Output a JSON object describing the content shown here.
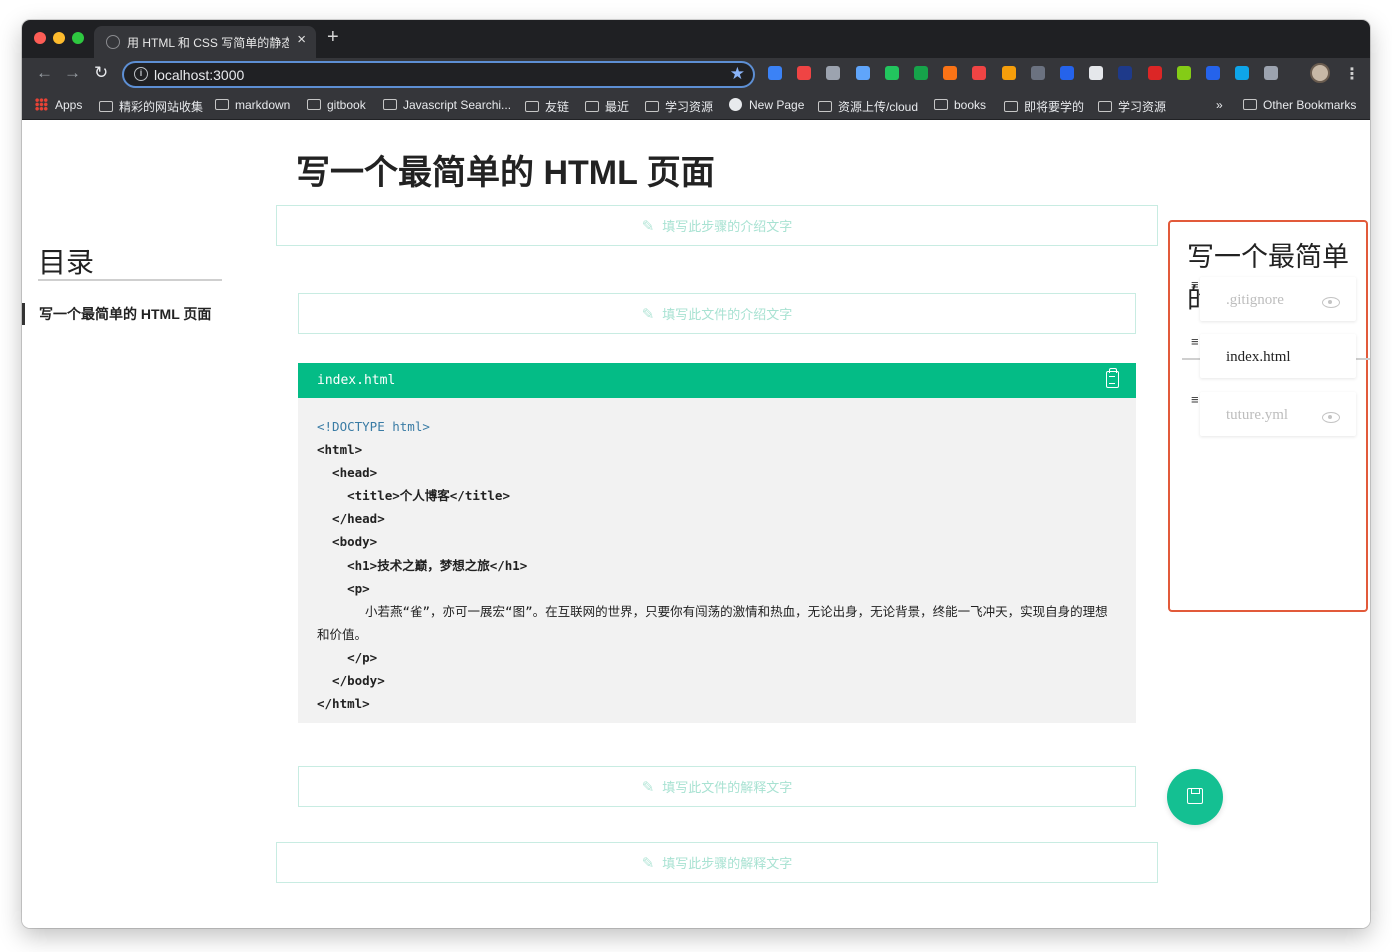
{
  "browser": {
    "tab_title": "用 HTML 和 CSS 写简单的静态页面",
    "tab_close": "×",
    "new_tab": "+",
    "nav": {
      "back": "←",
      "forward": "→",
      "reload": "↻"
    },
    "url": "localhost:3000",
    "star": "★",
    "menu": "⋮",
    "bookmarks": [
      {
        "label": "Apps",
        "icon": "apps-grid-icon"
      },
      {
        "label": "精彩的网站收集",
        "icon": "folder-icon"
      },
      {
        "label": "markdown",
        "icon": "folder-icon"
      },
      {
        "label": "gitbook",
        "icon": "folder-icon"
      },
      {
        "label": "Javascript Searchi...",
        "icon": "folder-icon"
      },
      {
        "label": "友链",
        "icon": "folder-icon"
      },
      {
        "label": "最近",
        "icon": "folder-icon"
      },
      {
        "label": "学习资源",
        "icon": "folder-icon"
      },
      {
        "label": "New Page",
        "icon": "github-icon"
      },
      {
        "label": "资源上传/cloud",
        "icon": "folder-icon"
      },
      {
        "label": "books",
        "icon": "folder-icon"
      },
      {
        "label": "即将要学的",
        "icon": "folder-icon"
      },
      {
        "label": "学习资源",
        "icon": "folder-icon"
      },
      {
        "label": "»",
        "icon": "chevron-double-right-icon"
      },
      {
        "label": "Other Bookmarks",
        "icon": "folder-icon"
      }
    ],
    "extension_colors": [
      "#3b82f6",
      "#ef4444",
      "#9ca3af",
      "#60a5fa",
      "#22c55e",
      "#16a34a",
      "#f97316",
      "#ef4444",
      "#f59e0b",
      "#6b7280",
      "#2563eb",
      "#e5e7eb",
      "#1e3a8a",
      "#dc2626",
      "#84cc16",
      "#2563eb",
      "#0ea5e9",
      "#9ca3af"
    ]
  },
  "page": {
    "title": "写一个最简单的 HTML 页面",
    "toc": {
      "heading": "目录",
      "items": [
        "写一个最简单的 HTML 页面"
      ]
    },
    "placeholders": {
      "step_intro": "填写此步骤的介绍文字",
      "file_intro": "填写此文件的介绍文字",
      "file_explain": "填写此文件的解释文字",
      "step_explain": "填写此步骤的解释文字"
    },
    "code": {
      "filename": "index.html",
      "lines": [
        "<!DOCTYPE html>",
        "<html>",
        "  <head>",
        "    <title>个人博客</title>",
        "  </head>",
        "  <body>",
        "    <h1>技术之巅，梦想之旅</h1>",
        "    <p>",
        "      小若燕“雀”，亦可一展宏“图”。在互联网的世界，只要你有闯荡的激情和热血，无论出身，无论背景，终能一飞冲天，实现自身的理想和价值。",
        "    </p>",
        "  </body>",
        "</html>"
      ]
    },
    "accent_color": "#04bc86"
  },
  "right_panel": {
    "title": "写一个最简单的 HTML 页面",
    "handle_glyph": "≡",
    "files": [
      {
        "name": ".gitignore",
        "muted": true,
        "visible_toggle": true
      },
      {
        "name": "index.html",
        "muted": false,
        "visible_toggle": false
      },
      {
        "name": "tuture.yml",
        "muted": true,
        "visible_toggle": true
      }
    ],
    "highlight_color": "#e25a3a"
  }
}
